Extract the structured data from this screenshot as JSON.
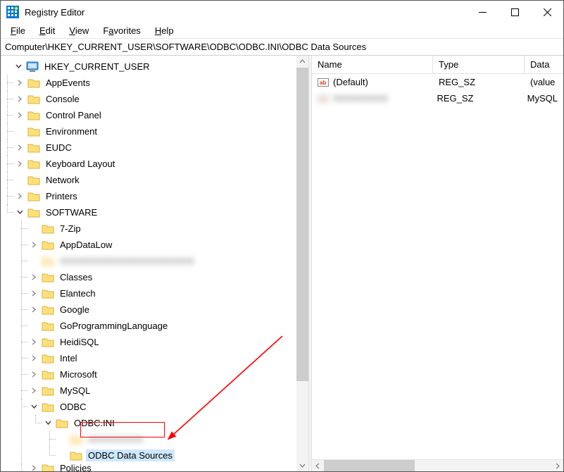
{
  "title": "Registry Editor",
  "menu": {
    "file": "File",
    "edit": "Edit",
    "view": "View",
    "favorites": "Favorites",
    "help": "Help"
  },
  "address": "Computer\\HKEY_CURRENT_USER\\SOFTWARE\\ODBC\\ODBC.INI\\ODBC Data Sources",
  "tree": {
    "root": "HKEY_CURRENT_USER",
    "items": [
      "AppEvents",
      "Console",
      "Control Panel",
      "Environment",
      "EUDC",
      "Keyboard Layout",
      "Network",
      "Printers"
    ],
    "software": "SOFTWARE",
    "software_items": [
      "7-Zip",
      "AppDataLow",
      "(blurred)",
      "Classes",
      "Elantech",
      "Google",
      "GoProgrammingLanguage",
      "HeidiSQL",
      "Intel",
      "Microsoft",
      "MySQL"
    ],
    "odbc": "ODBC",
    "odbc_ini": "ODBC.INI",
    "odbc_ini_children": [
      "(blurred)",
      "ODBC Data Sources"
    ],
    "next_partial": "Policies"
  },
  "details": {
    "columns": {
      "name": "Name",
      "type": "Type",
      "data": "Data"
    },
    "rows": [
      {
        "name": "(Default)",
        "type": "REG_SZ",
        "data": "(value"
      },
      {
        "name": "(blurred)",
        "type": "REG_SZ",
        "data": "MySQL"
      }
    ]
  }
}
